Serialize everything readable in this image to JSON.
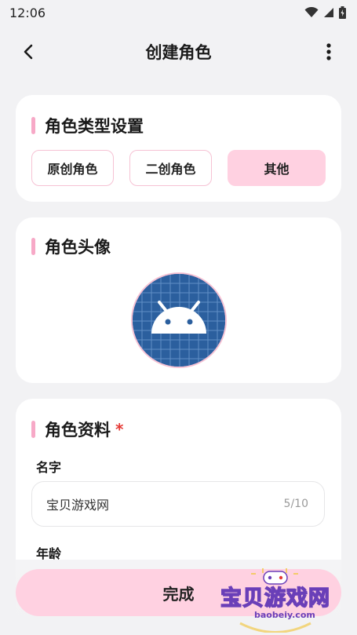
{
  "status_bar": {
    "time": "12:06"
  },
  "app_bar": {
    "title": "创建角色"
  },
  "type_section": {
    "title": "角色类型设置",
    "options": [
      {
        "label": "原创角色",
        "selected": false
      },
      {
        "label": "二创角色",
        "selected": false
      },
      {
        "label": "其他",
        "selected": true
      }
    ]
  },
  "avatar_section": {
    "title": "角色头像"
  },
  "profile_section": {
    "title": "角色资料",
    "required_mark": "*",
    "name_label": "名字",
    "name_value": "宝贝游戏网",
    "name_count": "5/10",
    "age_label": "年龄"
  },
  "footer": {
    "done_label": "完成"
  },
  "watermark": {
    "text": "宝贝游戏网",
    "url": "baobeiy.com"
  },
  "colors": {
    "accent_pink": "#ffd1e1",
    "bar_pink": "#f7a9c7",
    "avatar_blue": "#2b5f9e"
  }
}
